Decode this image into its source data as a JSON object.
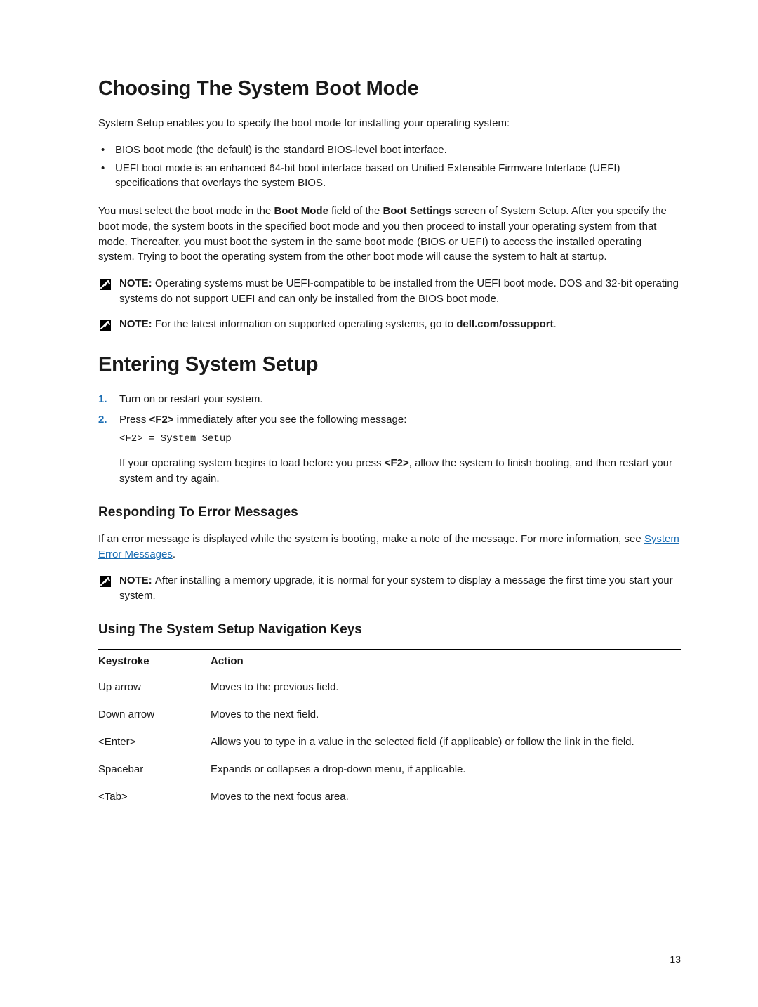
{
  "h1": "Choosing The System Boot Mode",
  "intro_para": "System Setup enables you to specify the boot mode for installing your operating system:",
  "bullets": [
    "BIOS boot mode (the default) is the standard BIOS-level boot interface.",
    "UEFI boot mode is an enhanced 64-bit boot interface based on Unified Extensible Firmware Interface (UEFI) specifications that overlays the system BIOS."
  ],
  "para2_pre": "You must select the boot mode in the ",
  "para2_b1": "Boot Mode",
  "para2_mid": " field of the ",
  "para2_b2": "Boot Settings",
  "para2_post": " screen of System Setup. After you specify the boot mode, the system boots in the specified boot mode and you then proceed to install your operating system from that mode. Thereafter, you must boot the system in the same boot mode (BIOS or UEFI) to access the installed operating system. Trying to boot the operating system from the other boot mode will cause the system to halt at startup.",
  "note1_label": "NOTE: ",
  "note1_text": "Operating systems must be UEFI-compatible to be installed from the UEFI boot mode. DOS and 32-bit operating systems do not support UEFI and can only be installed from the BIOS boot mode.",
  "note2_label": "NOTE: ",
  "note2_pre": "For the latest information on supported operating systems, go to ",
  "note2_b": "dell.com/ossupport",
  "note2_post": ".",
  "h2": "Entering System Setup",
  "step1": "Turn on or restart your system.",
  "step2_pre": "Press ",
  "step2_b": "<F2>",
  "step2_post": " immediately after you see the following message:",
  "step2_code": "<F2> = System Setup",
  "step2_sub_pre": "If your operating system begins to load before you press ",
  "step2_sub_b": "<F2>",
  "step2_sub_post": ", allow the system to finish booting, and then restart your system and try again.",
  "h3a": "Responding To Error Messages",
  "err_para_pre": "If an error message is displayed while the system is booting, make a note of the message. For more information, see ",
  "err_link": "System Error Messages",
  "err_para_post": ".",
  "note3_label": "NOTE: ",
  "note3_text": "After installing a memory upgrade, it is normal for your system to display a message the first time you start your system.",
  "h3b": "Using The System Setup Navigation Keys",
  "th1": "Keystroke",
  "th2": "Action",
  "rows": [
    {
      "k": "Up arrow",
      "a": "Moves to the previous field."
    },
    {
      "k": "Down arrow",
      "a": "Moves to the next field."
    },
    {
      "k": "<Enter>",
      "a": "Allows you to type in a value in the selected field (if applicable) or follow the link in the field."
    },
    {
      "k": "Spacebar",
      "a": "Expands or collapses a drop-down menu, if applicable."
    },
    {
      "k": "<Tab>",
      "a": "Moves to the next focus area."
    }
  ],
  "pagenum": "13"
}
